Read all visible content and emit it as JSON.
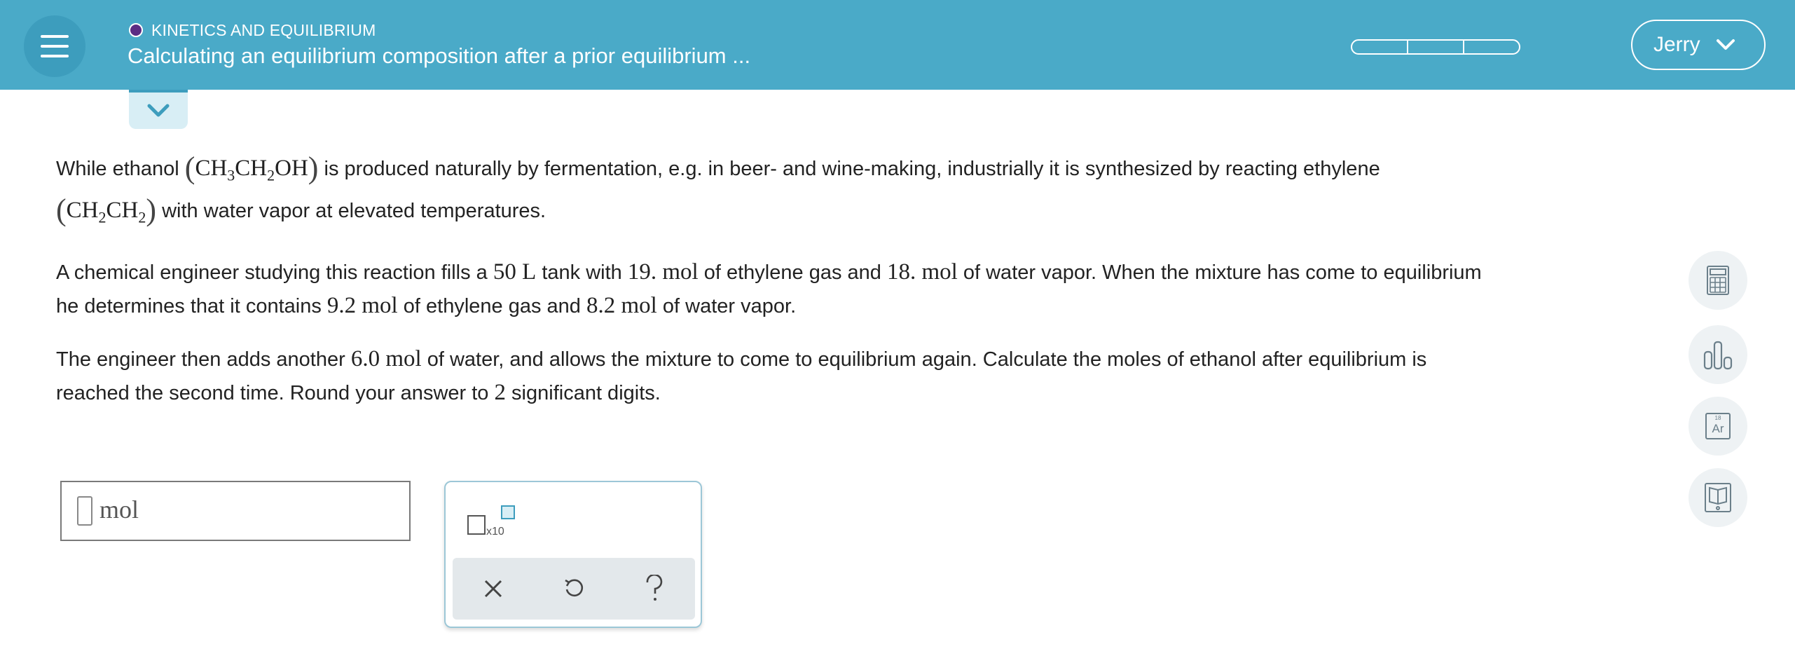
{
  "header": {
    "topic": "KINETICS AND EQUILIBRIUM",
    "title": "Calculating an equilibrium composition after a prior equilibrium ...",
    "user_name": "Jerry",
    "progress_segments": 3
  },
  "icons": {
    "menu": "hamburger-icon",
    "collapse": "chevron-down-icon",
    "user_menu": "chevron-down-icon",
    "tools": [
      "calculator-icon",
      "data-chart-icon",
      "periodic-table-icon",
      "reference-book-icon"
    ]
  },
  "problem": {
    "p1_a": "While ethanol",
    "p1_b": "is produced naturally by fermentation, e.g. in beer- and wine-making, industrially it is synthesized by reacting ethylene",
    "p1_c": "with water vapor at elevated temperatures.",
    "p2_a": "A chemical engineer studying this reaction fills a",
    "tank": "50 L",
    "p2_b": "tank with",
    "ethylene_initial": "19. mol",
    "p2_c": "of ethylene gas and",
    "water_initial": "18. mol",
    "p2_d": "of water vapor. When the mixture has come to equilibrium",
    "p2_e": "he determines that it contains",
    "ethylene_eq": "9.2 mol",
    "p2_f": "of ethylene gas and",
    "water_eq": "8.2 mol",
    "p2_g": "of water vapor.",
    "p3_a": "The engineer then adds another",
    "water_added": "6.0 mol",
    "p3_b": "of water, and allows the mixture to come to equilibrium again. Calculate the moles of ethanol after equilibrium is",
    "p3_c": "reached the second time. Round your answer to",
    "sig_digits": "2",
    "p3_d": "significant digits."
  },
  "answer": {
    "unit": "mol"
  },
  "palette": {
    "sci_label": "x10"
  },
  "periodic": {
    "number": "18",
    "symbol": "Ar"
  },
  "colors": {
    "header": "#4aaac8",
    "accent": "#3d9dbd",
    "topic_dot": "#5b2c83"
  }
}
